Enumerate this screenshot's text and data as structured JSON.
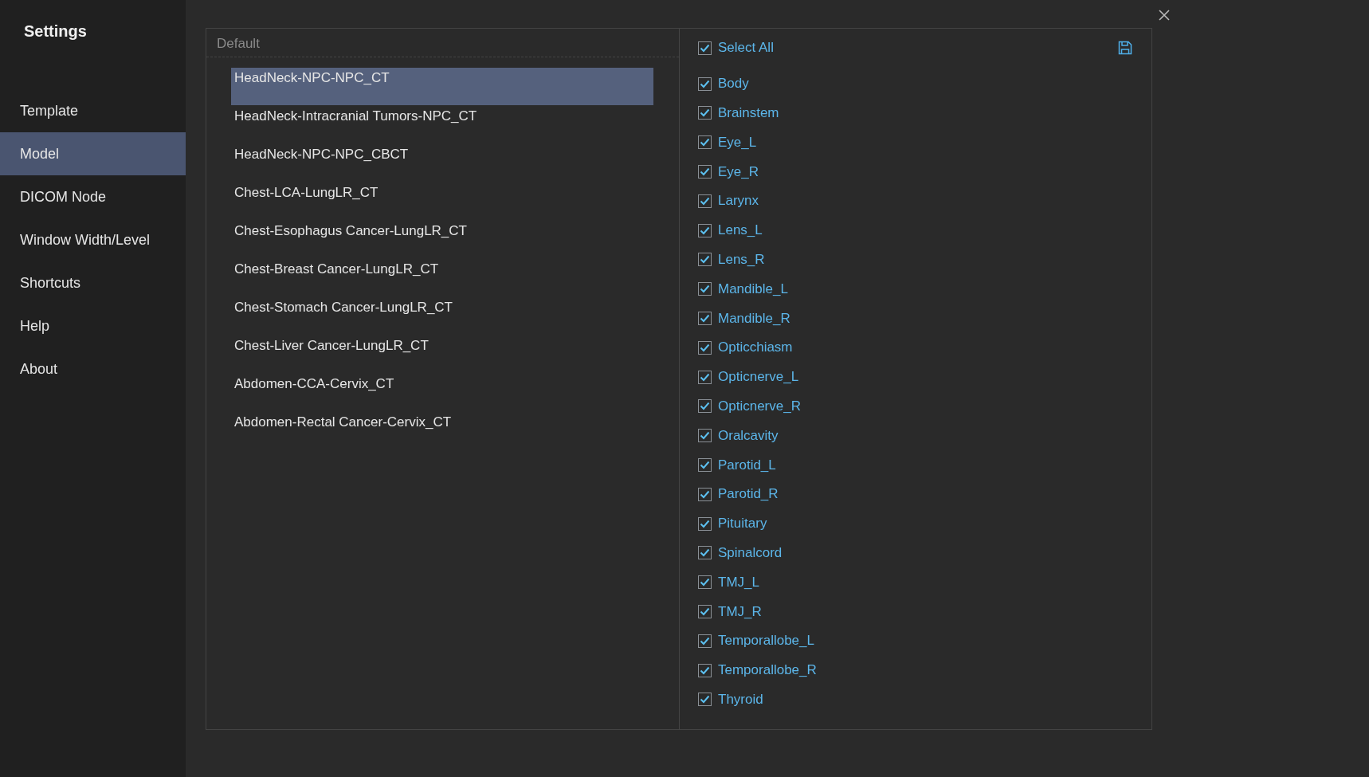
{
  "sidebar": {
    "title": "Settings",
    "items": [
      {
        "label": "Template",
        "selected": false
      },
      {
        "label": "Model",
        "selected": true
      },
      {
        "label": "DICOM Node",
        "selected": false
      },
      {
        "label": "Window Width/Level",
        "selected": false
      },
      {
        "label": "Shortcuts",
        "selected": false
      },
      {
        "label": "Help",
        "selected": false
      },
      {
        "label": "About",
        "selected": false
      }
    ]
  },
  "model_list": {
    "header": "Default",
    "items": [
      {
        "label": "HeadNeck-NPC-NPC_CT",
        "selected": true
      },
      {
        "label": "HeadNeck-Intracranial Tumors-NPC_CT",
        "selected": false
      },
      {
        "label": "HeadNeck-NPC-NPC_CBCT",
        "selected": false
      },
      {
        "label": "Chest-LCA-LungLR_CT",
        "selected": false
      },
      {
        "label": "Chest-Esophagus Cancer-LungLR_CT",
        "selected": false
      },
      {
        "label": "Chest-Breast Cancer-LungLR_CT",
        "selected": false
      },
      {
        "label": "Chest-Stomach Cancer-LungLR_CT",
        "selected": false
      },
      {
        "label": "Chest-Liver Cancer-LungLR_CT",
        "selected": false
      },
      {
        "label": "Abdomen-CCA-Cervix_CT",
        "selected": false
      },
      {
        "label": "Abdomen-Rectal Cancer-Cervix_CT",
        "selected": false
      }
    ]
  },
  "structures": {
    "select_all": {
      "label": "Select All",
      "checked": true
    },
    "items": [
      {
        "label": "Body",
        "checked": true
      },
      {
        "label": "Brainstem",
        "checked": true
      },
      {
        "label": "Eye_L",
        "checked": true
      },
      {
        "label": "Eye_R",
        "checked": true
      },
      {
        "label": "Larynx",
        "checked": true
      },
      {
        "label": "Lens_L",
        "checked": true
      },
      {
        "label": "Lens_R",
        "checked": true
      },
      {
        "label": "Mandible_L",
        "checked": true
      },
      {
        "label": "Mandible_R",
        "checked": true
      },
      {
        "label": "Opticchiasm",
        "checked": true
      },
      {
        "label": "Opticnerve_L",
        "checked": true
      },
      {
        "label": "Opticnerve_R",
        "checked": true
      },
      {
        "label": "Oralcavity",
        "checked": true
      },
      {
        "label": "Parotid_L",
        "checked": true
      },
      {
        "label": "Parotid_R",
        "checked": true
      },
      {
        "label": "Pituitary",
        "checked": true
      },
      {
        "label": "Spinalcord",
        "checked": true
      },
      {
        "label": "TMJ_L",
        "checked": true
      },
      {
        "label": "TMJ_R",
        "checked": true
      },
      {
        "label": "Temporallobe_L",
        "checked": true
      },
      {
        "label": "Temporallobe_R",
        "checked": true
      },
      {
        "label": "Thyroid",
        "checked": true
      }
    ]
  }
}
